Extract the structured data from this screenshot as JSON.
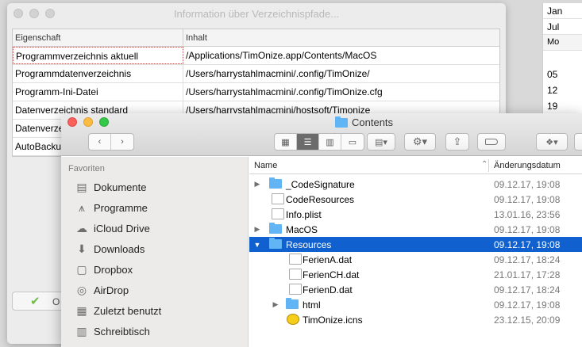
{
  "back_window": {
    "title": "Information über Verzeichnispfade...",
    "columns": [
      "Eigenschaft",
      "Inhalt"
    ],
    "rows": [
      {
        "property": "Programmverzeichnis aktuell",
        "value": "/Applications/TimOnize.app/Contents/MacOS"
      },
      {
        "property": "Programmdatenverzeichnis",
        "value": "/Users/harrystahlmacmini/.config/TimOnize/"
      },
      {
        "property": "Programm-Ini-Datei",
        "value": "/Users/harrystahlmacmini/.config/TimOnize.cfg"
      },
      {
        "property": "Datenverzeichnis standard",
        "value": "/Users/harrystahlmacmini/hostsoft/Timonize"
      },
      {
        "property": "Datenverze",
        "value": ""
      },
      {
        "property": "AutoBacku",
        "value": ""
      }
    ],
    "ok_label": "O"
  },
  "calendar": {
    "months": [
      "Jan",
      "Jul"
    ],
    "weekday": "Mo",
    "days": [
      "05",
      "12",
      "19"
    ]
  },
  "finder": {
    "title": "Contents",
    "sidebar": {
      "section": "Favoriten",
      "items": [
        {
          "label": "Dokumente",
          "icon": "documents-icon"
        },
        {
          "label": "Programme",
          "icon": "applications-icon"
        },
        {
          "label": "iCloud Drive",
          "icon": "icloud-icon"
        },
        {
          "label": "Downloads",
          "icon": "downloads-icon"
        },
        {
          "label": "Dropbox",
          "icon": "dropbox-icon"
        },
        {
          "label": "AirDrop",
          "icon": "airdrop-icon"
        },
        {
          "label": "Zuletzt benutzt",
          "icon": "recents-icon"
        },
        {
          "label": "Schreibtisch",
          "icon": "desktop-icon"
        }
      ]
    },
    "list": {
      "col_name": "Name",
      "col_date": "Änderungsdatum",
      "files": [
        {
          "name": "_CodeSignature",
          "date": "09.12.17, 19:08",
          "kind": "folder",
          "level": 0,
          "disclosure": "closed"
        },
        {
          "name": "CodeResources",
          "date": "09.12.17, 19:08",
          "kind": "file",
          "level": 0,
          "disclosure": "none"
        },
        {
          "name": "Info.plist",
          "date": "13.01.16, 23:56",
          "kind": "file",
          "level": 0,
          "disclosure": "none"
        },
        {
          "name": "MacOS",
          "date": "09.12.17, 19:08",
          "kind": "folder",
          "level": 0,
          "disclosure": "closed"
        },
        {
          "name": "Resources",
          "date": "09.12.17, 19:08",
          "kind": "folder",
          "level": 0,
          "disclosure": "open",
          "selected": true
        },
        {
          "name": "FerienA.dat",
          "date": "09.12.17, 18:24",
          "kind": "file",
          "level": 1,
          "disclosure": "none"
        },
        {
          "name": "FerienCH.dat",
          "date": "21.01.17, 17:28",
          "kind": "file",
          "level": 1,
          "disclosure": "none"
        },
        {
          "name": "FerienD.dat",
          "date": "09.12.17, 18:24",
          "kind": "file",
          "level": 1,
          "disclosure": "none"
        },
        {
          "name": "html",
          "date": "09.12.17, 19:08",
          "kind": "folder",
          "level": 1,
          "disclosure": "closed"
        },
        {
          "name": "TimOnize.icns",
          "date": "23.12.15, 20:09",
          "kind": "icns",
          "level": 1,
          "disclosure": "none"
        }
      ]
    }
  },
  "colors": {
    "selection": "#1060cf",
    "folder": "#62b5f5",
    "close": "#fc605b",
    "minimize": "#fdbc40",
    "zoom": "#34c84a"
  }
}
